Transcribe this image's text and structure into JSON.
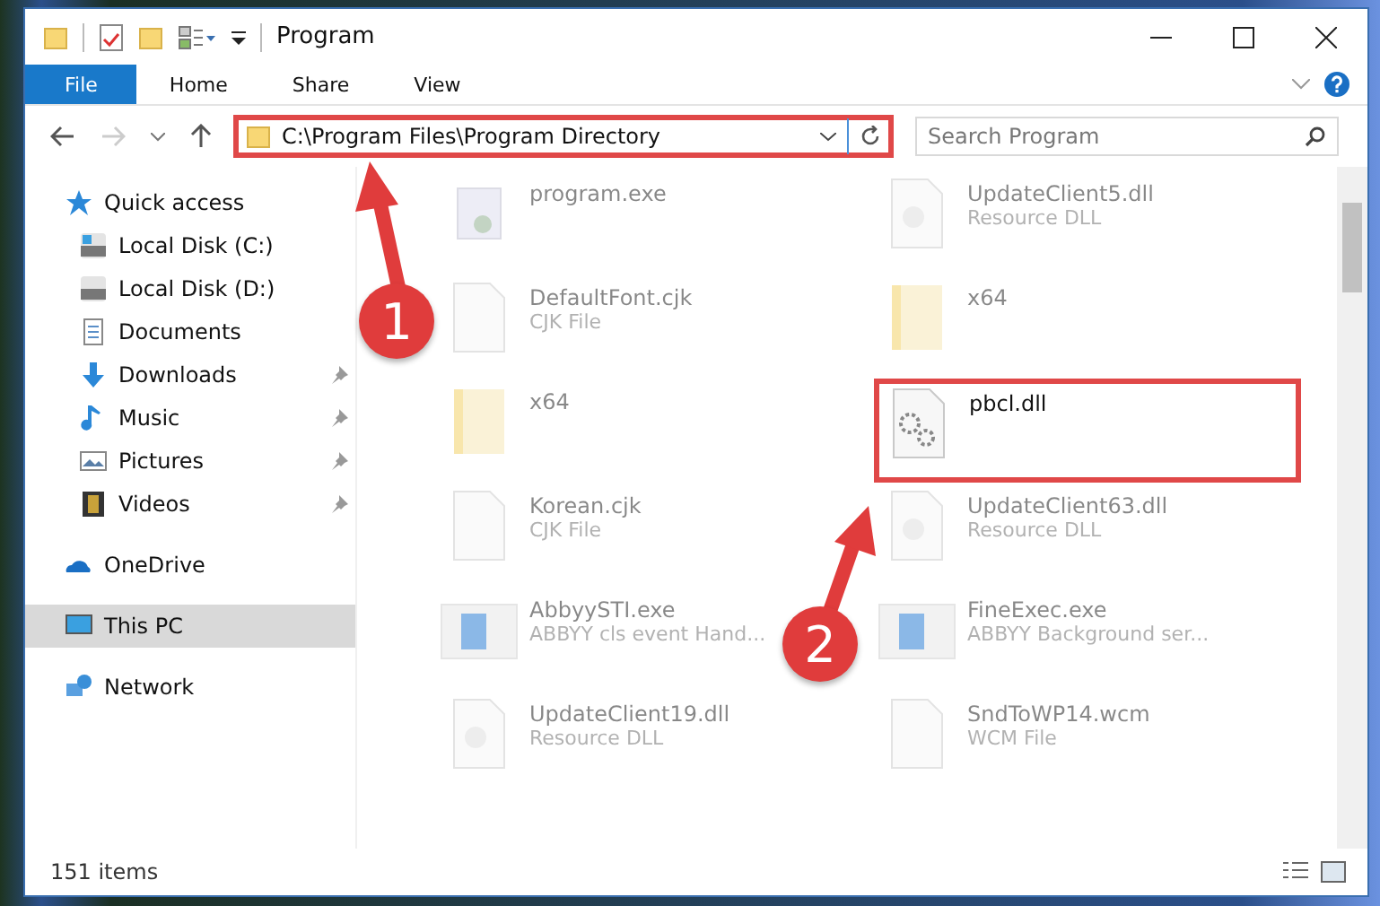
{
  "window": {
    "title": "Program"
  },
  "ribbon_tabs": [
    {
      "label": "File",
      "selected": true
    },
    {
      "label": "Home",
      "selected": false
    },
    {
      "label": "Share",
      "selected": false
    },
    {
      "label": "View",
      "selected": false
    }
  ],
  "address_bar": {
    "path": "C:\\Program Files\\Program Directory",
    "highlighted": true
  },
  "search": {
    "placeholder": "Search Program"
  },
  "sidebar": {
    "items": [
      {
        "label": "Quick access",
        "kind": "star",
        "selected": false,
        "children": [
          {
            "label": "Local Disk (C:)",
            "kind": "disk-c",
            "pinned": false,
            "selected": false
          },
          {
            "label": "Local Disk (D:)",
            "kind": "disk",
            "pinned": false,
            "selected": false
          },
          {
            "label": "Documents",
            "kind": "doc",
            "pinned": false,
            "selected": false
          },
          {
            "label": "Downloads",
            "kind": "download",
            "pinned": true,
            "selected": false
          },
          {
            "label": "Music",
            "kind": "music",
            "pinned": true,
            "selected": false
          },
          {
            "label": "Pictures",
            "kind": "picture",
            "pinned": true,
            "selected": false
          },
          {
            "label": "Videos",
            "kind": "video",
            "pinned": true,
            "selected": false
          }
        ]
      },
      {
        "label": "OneDrive",
        "kind": "cloud",
        "selected": false
      },
      {
        "label": "This PC",
        "kind": "pc",
        "selected": true
      },
      {
        "label": "Network",
        "kind": "network",
        "selected": false
      }
    ]
  },
  "files": [
    {
      "name": "program.exe",
      "kind": "exe",
      "highlighted": false
    },
    {
      "name": "UpdateClient5.dll",
      "type": "Resource DLL",
      "kind": "dll",
      "highlighted": false
    },
    {
      "name": "DefaultFont.cjk",
      "type": "CJK File",
      "kind": "file",
      "highlighted": false
    },
    {
      "name": "x64",
      "kind": "folder",
      "highlighted": false
    },
    {
      "name": "x64",
      "kind": "folder",
      "highlighted": false
    },
    {
      "name": "pbcl.dll",
      "kind": "gear",
      "highlighted": true
    },
    {
      "name": "Korean.cjk",
      "type": "CJK File",
      "kind": "file",
      "highlighted": false
    },
    {
      "name": "UpdateClient63.dll",
      "type": "Resource DLL",
      "kind": "dll",
      "highlighted": false
    },
    {
      "name": "AbbyySTI.exe",
      "type": "ABBYY cls event Hand...",
      "kind": "app",
      "highlighted": false
    },
    {
      "name": "FineExec.exe",
      "type": "ABBYY Background ser...",
      "kind": "app",
      "highlighted": false
    },
    {
      "name": "UpdateClient19.dll",
      "type": "Resource DLL",
      "kind": "dll",
      "highlighted": false
    },
    {
      "name": "SndToWP14.wcm",
      "type": "WCM File",
      "kind": "file",
      "highlighted": false
    }
  ],
  "status_bar": {
    "count": "151 items"
  },
  "annotations": [
    {
      "label": "1"
    },
    {
      "label": "2"
    }
  ]
}
